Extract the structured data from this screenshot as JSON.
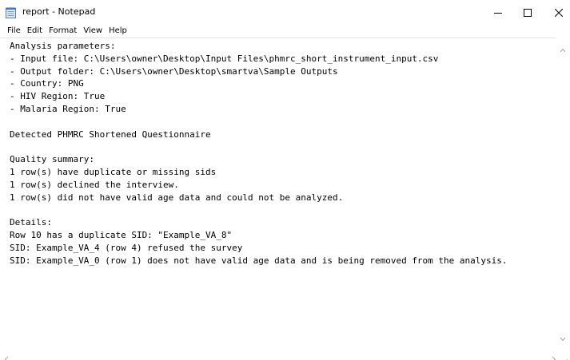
{
  "window": {
    "title": "report - Notepad",
    "icon": "notepad-icon",
    "controls": {
      "minimize_icon": "minimize-icon",
      "maximize_icon": "maximize-icon",
      "close_icon": "close-icon"
    }
  },
  "menu": {
    "items": [
      "File",
      "Edit",
      "Format",
      "View",
      "Help"
    ]
  },
  "document": {
    "lines": [
      "Analysis parameters:",
      "- Input file: C:\\Users\\owner\\Desktop\\Input Files\\phmrc_short_instrument_input.csv",
      "- Output folder: C:\\Users\\owner\\Desktop\\smartva\\Sample Outputs",
      "- Country: PNG",
      "- HIV Region: True",
      "- Malaria Region: True",
      "",
      "Detected PHMRC Shortened Questionnaire",
      "",
      "Quality summary:",
      "1 row(s) have duplicate or missing sids",
      "1 row(s) declined the interview.",
      "1 row(s) did not have valid age data and could not be analyzed.",
      "",
      "Details:",
      "Row 10 has a duplicate SID: \"Example_VA_8\"",
      "SID: Example_VA_4 (row 4) refused the survey",
      "SID: Example_VA_0 (row 1) does not have valid age data and is being removed from the analysis."
    ]
  },
  "scrollbars": {
    "up_icon": "scroll-up-arrow-icon",
    "down_icon": "scroll-down-arrow-icon",
    "left_icon": "scroll-left-arrow-icon",
    "right_icon": "scroll-right-arrow-icon"
  },
  "colors": {
    "text": "#000000",
    "background": "#ffffff",
    "scroll_arrow": "#a6a6a6"
  }
}
